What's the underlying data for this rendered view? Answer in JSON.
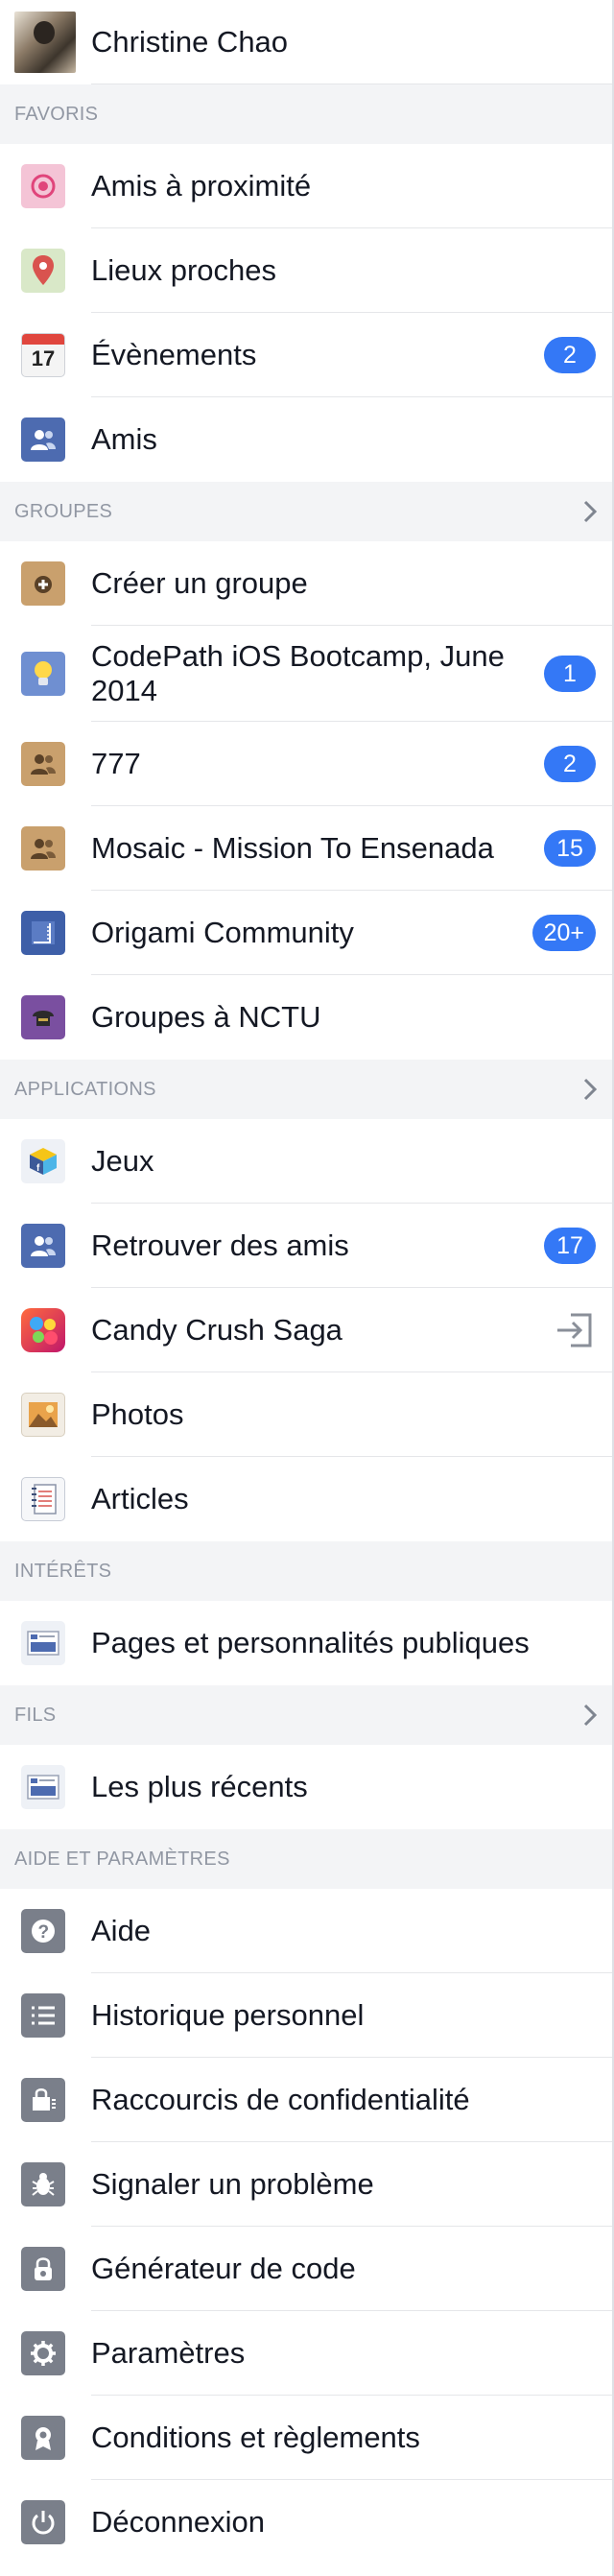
{
  "profile": {
    "name": "Christine Chao"
  },
  "sections": {
    "favorites": "FAVORIS",
    "groups": "GROUPES",
    "apps": "APPLICATIONS",
    "interests": "INTÉRÊTS",
    "feeds": "FILS",
    "help": "AIDE ET PARAMÈTRES"
  },
  "favorites": [
    {
      "label": "Amis à proximité",
      "icon": "nearby-friends-icon"
    },
    {
      "label": "Lieux proches",
      "icon": "map-pin-icon"
    },
    {
      "label": "Évènements",
      "icon": "calendar-icon",
      "badge": "2",
      "calendar_day": "17"
    },
    {
      "label": "Amis",
      "icon": "friends-icon"
    }
  ],
  "groups": [
    {
      "label": "Créer un groupe",
      "icon": "create-group-icon"
    },
    {
      "label": "CodePath iOS Bootcamp, June 2014",
      "icon": "lightbulb-icon",
      "badge": "1"
    },
    {
      "label": "777",
      "icon": "group-icon",
      "badge": "2"
    },
    {
      "label": "Mosaic - Mission To Ensenada",
      "icon": "group-icon",
      "badge": "15"
    },
    {
      "label": "Origami Community",
      "icon": "origami-icon",
      "badge": "20+"
    },
    {
      "label": "Groupes à NCTU",
      "icon": "nctu-group-icon"
    }
  ],
  "apps": [
    {
      "label": "Jeux",
      "icon": "games-icon"
    },
    {
      "label": "Retrouver des amis",
      "icon": "find-friends-icon",
      "badge": "17"
    },
    {
      "label": "Candy Crush Saga",
      "icon": "candy-crush-icon"
    },
    {
      "label": "Photos",
      "icon": "photos-icon"
    },
    {
      "label": "Articles",
      "icon": "notes-icon"
    }
  ],
  "interests": [
    {
      "label": "Pages et personnalités publiques",
      "icon": "pages-feed-icon"
    }
  ],
  "feeds": [
    {
      "label": "Les plus récents",
      "icon": "news-feed-icon"
    }
  ],
  "help": [
    {
      "label": "Aide",
      "icon": "help-icon"
    },
    {
      "label": "Historique personnel",
      "icon": "activity-log-icon"
    },
    {
      "label": "Raccourcis de confidentialité",
      "icon": "privacy-icon"
    },
    {
      "label": "Signaler un problème",
      "icon": "bug-icon"
    },
    {
      "label": "Générateur de code",
      "icon": "code-generator-icon"
    },
    {
      "label": "Paramètres",
      "icon": "settings-icon"
    },
    {
      "label": "Conditions et règlements",
      "icon": "terms-icon"
    },
    {
      "label": "Déconnexion",
      "icon": "logout-icon"
    }
  ],
  "colors": {
    "badge": "#3478f6",
    "section_bg": "#f3f4f6",
    "section_text": "#9197a3",
    "text": "#141823"
  }
}
